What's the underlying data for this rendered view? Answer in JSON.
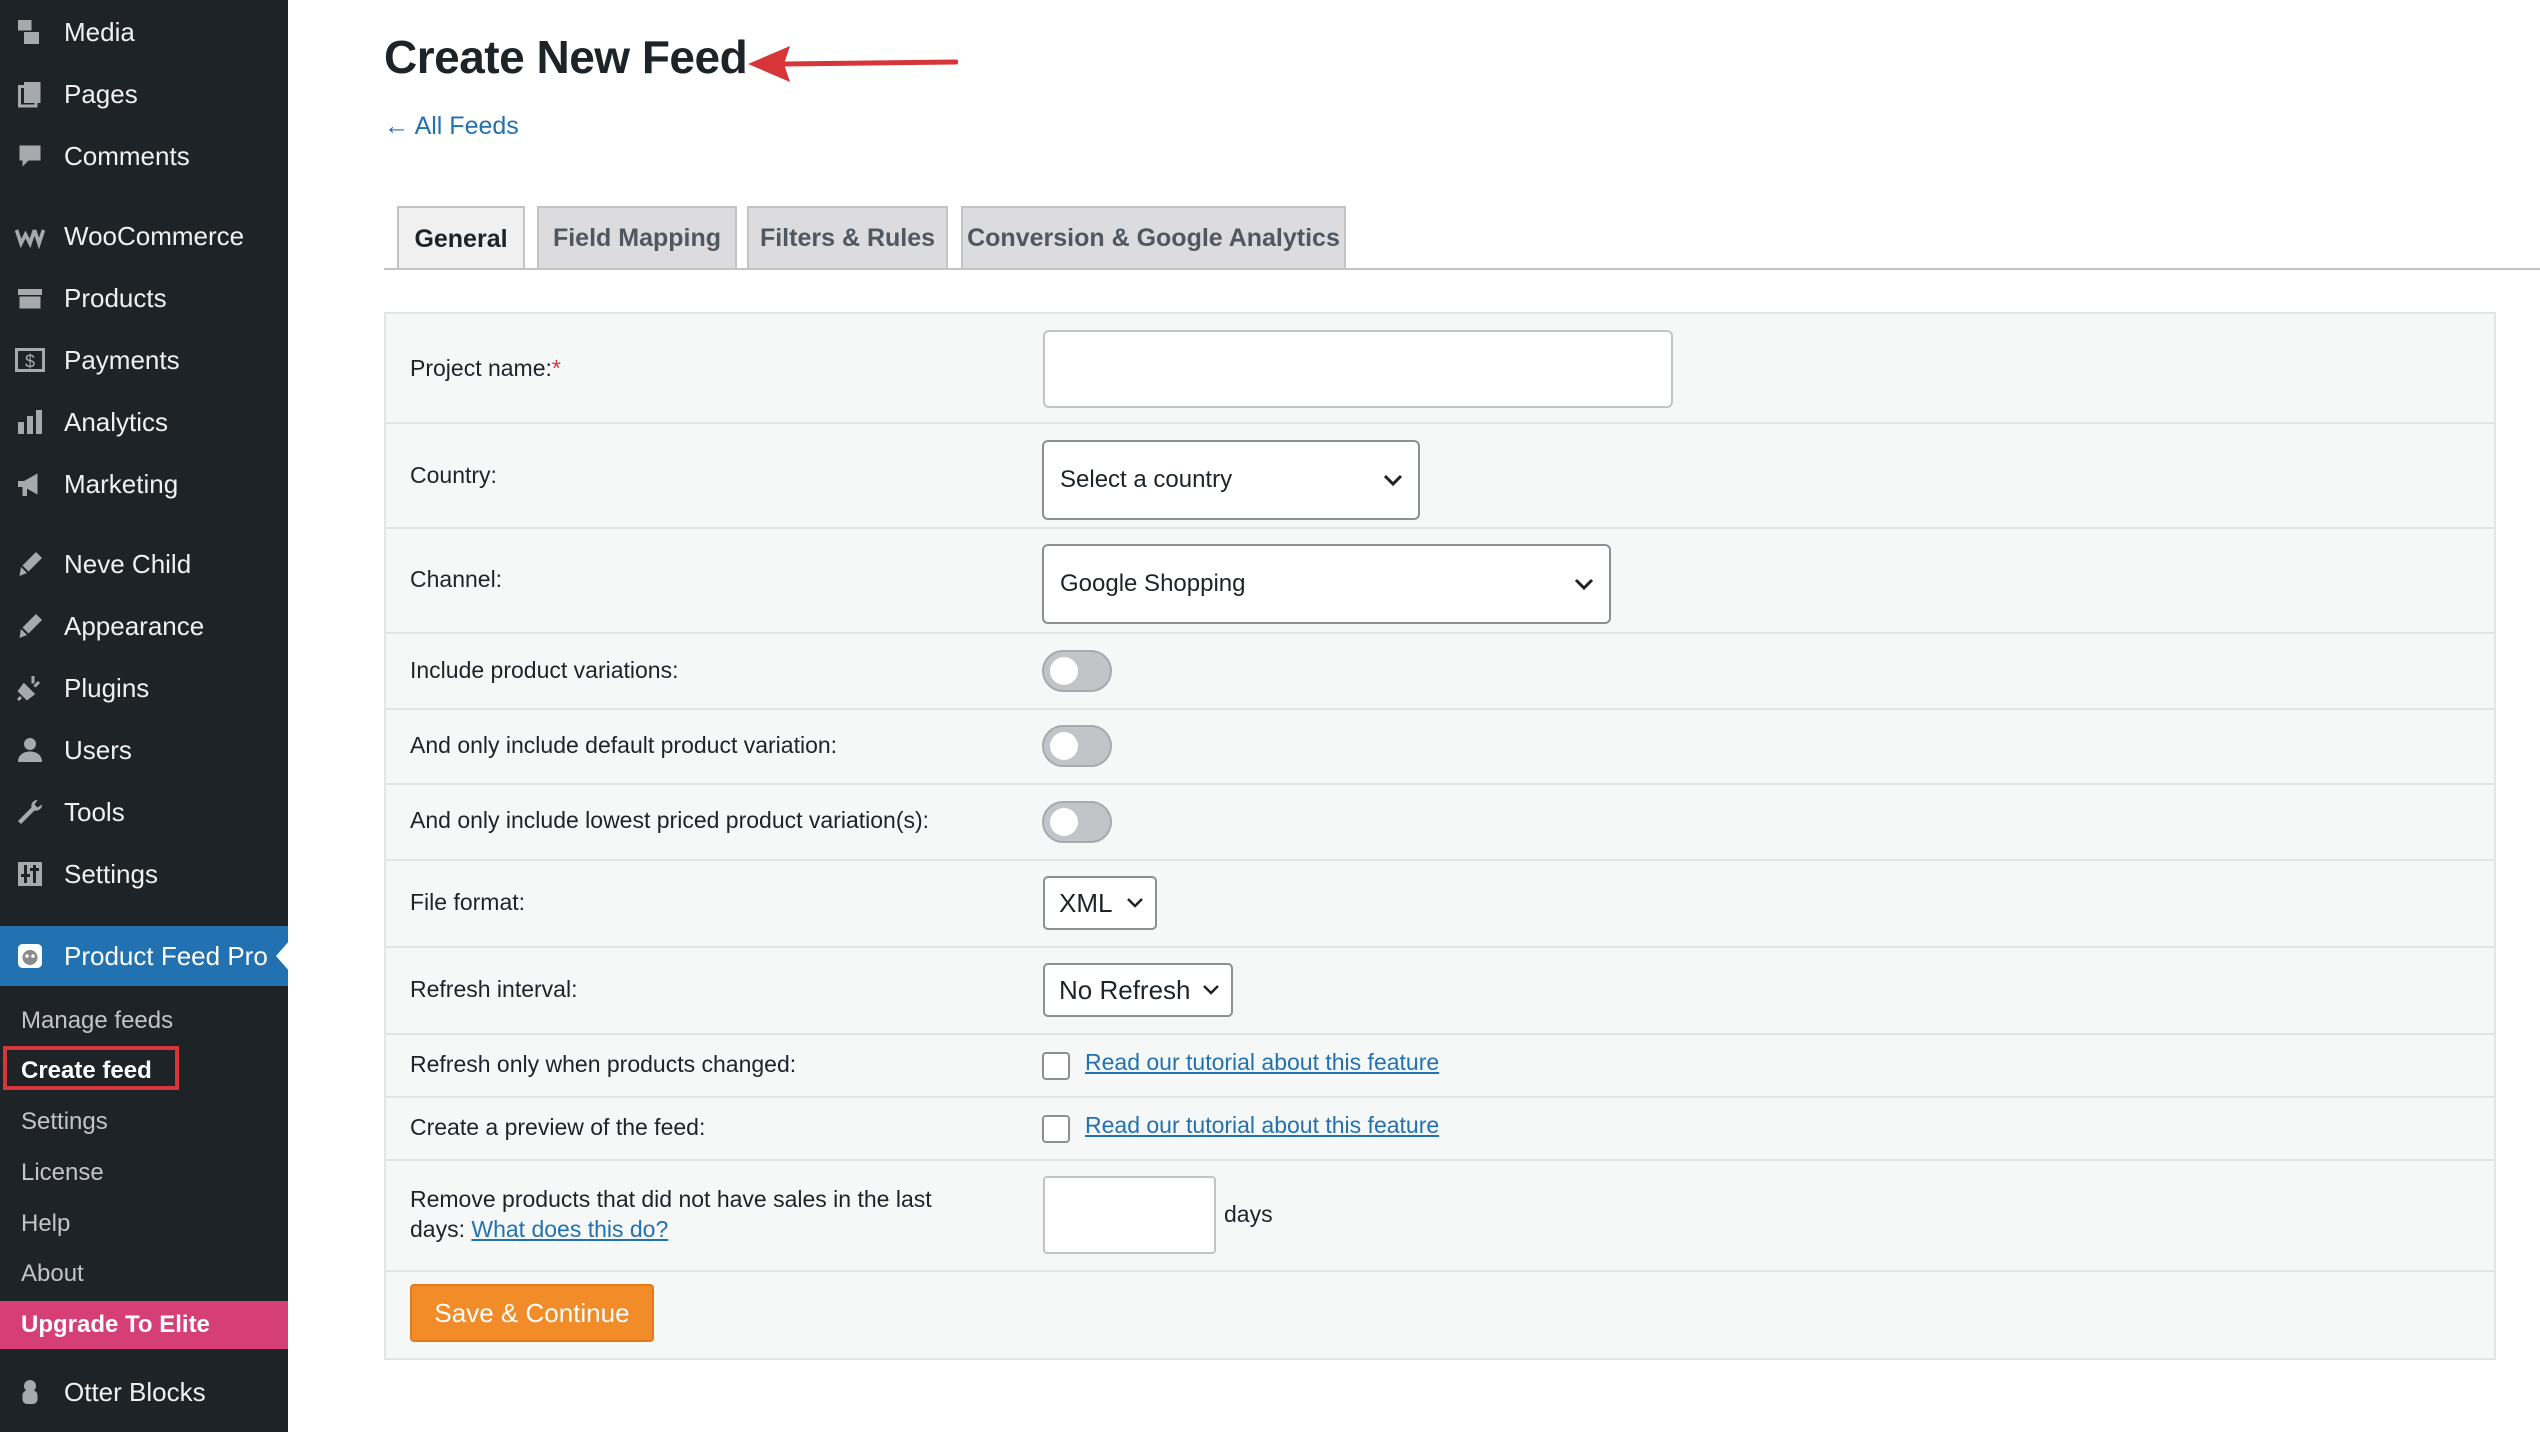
{
  "sidebar": {
    "menu": [
      {
        "label": "Media",
        "icon": "media-icon"
      },
      {
        "label": "Pages",
        "icon": "pages-icon"
      },
      {
        "label": "Comments",
        "icon": "comments-icon"
      },
      {
        "label": "WooCommerce",
        "icon": "woocommerce-icon"
      },
      {
        "label": "Products",
        "icon": "products-icon"
      },
      {
        "label": "Payments",
        "icon": "payments-icon"
      },
      {
        "label": "Analytics",
        "icon": "analytics-icon"
      },
      {
        "label": "Marketing",
        "icon": "marketing-icon"
      },
      {
        "label": "Neve Child",
        "icon": "brush-icon"
      },
      {
        "label": "Appearance",
        "icon": "appearance-icon"
      },
      {
        "label": "Plugins",
        "icon": "plugins-icon"
      },
      {
        "label": "Users",
        "icon": "users-icon"
      },
      {
        "label": "Tools",
        "icon": "tools-icon"
      },
      {
        "label": "Settings",
        "icon": "settings-icon"
      },
      {
        "label": "Product Feed Pro",
        "icon": "product-feed-pro-icon"
      },
      {
        "label": "Otter Blocks",
        "icon": "otter-icon"
      }
    ],
    "submenu": [
      {
        "label": "Manage feeds"
      },
      {
        "label": "Create feed"
      },
      {
        "label": "Settings"
      },
      {
        "label": "License"
      },
      {
        "label": "Help"
      },
      {
        "label": "About"
      },
      {
        "label": "Upgrade To Elite"
      }
    ],
    "colors": {
      "background": "#1d2327",
      "active": "#2271b1",
      "upgrade": "#d63f76",
      "highlight_box": "#d63638"
    }
  },
  "header": {
    "title": "Create New Feed",
    "back_link": "← All Feeds"
  },
  "tabs": [
    {
      "label": "General",
      "active": true
    },
    {
      "label": "Field Mapping",
      "active": false
    },
    {
      "label": "Filters & Rules",
      "active": false
    },
    {
      "label": "Conversion & Google Analytics",
      "active": false
    }
  ],
  "form": {
    "project_name": {
      "label": "Project name:",
      "required_mark": "*",
      "value": ""
    },
    "country": {
      "label": "Country:",
      "selected": "Select a country"
    },
    "channel": {
      "label": "Channel:",
      "selected": "Google Shopping"
    },
    "include_variations": {
      "label": "Include product variations:",
      "on": false
    },
    "default_variation": {
      "label": "And only include default product variation:",
      "on": false
    },
    "lowest_priced_variation": {
      "label": "And only include lowest priced product variation(s):",
      "on": false
    },
    "file_format": {
      "label": "File format:",
      "selected": "XML"
    },
    "refresh_interval": {
      "label": "Refresh interval:",
      "selected": "No Refresh"
    },
    "refresh_when_changed": {
      "label": "Refresh only when products changed:",
      "checked": false,
      "link": "Read our tutorial about this feature"
    },
    "preview": {
      "label": "Create a preview of the feed:",
      "checked": false,
      "link": "Read our tutorial about this feature"
    },
    "remove_no_sales": {
      "label_line1": "Remove products that did not have sales in the last",
      "label_line2": "days:",
      "link": "What does this do?",
      "value": "",
      "unit": "days"
    },
    "save_button": "Save & Continue"
  },
  "colors": {
    "link": "#2271b1",
    "button": "#f28c28",
    "arrow": "#d63638"
  }
}
